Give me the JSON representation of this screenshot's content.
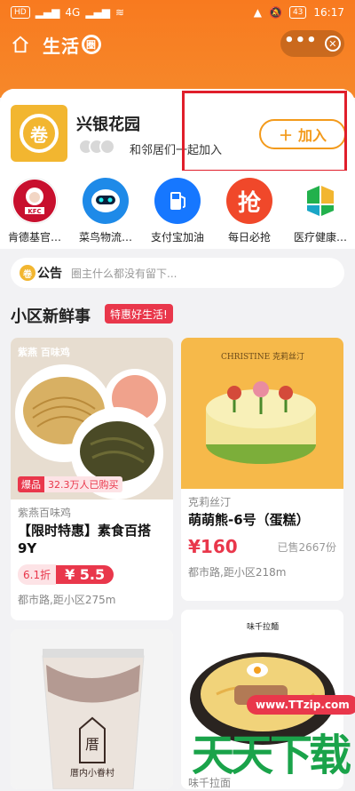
{
  "status": {
    "time": "16:17",
    "battery": "43",
    "hd": "HD",
    "net1": "4G",
    "net2": "4G"
  },
  "navbar": {
    "title": "生活",
    "title_ring": "圈"
  },
  "community": {
    "logo_char": "卷",
    "name": "兴银花园",
    "subtitle": "和邻居们一起加入",
    "join_label": "加入"
  },
  "apps": [
    {
      "label": "肯德基官…",
      "icon": "kfc-icon",
      "color": "#c8102e",
      "glyph": "KFC"
    },
    {
      "label": "菜鸟物流…",
      "icon": "robot-icon",
      "color": "#1e8ae8",
      "glyph": "●●"
    },
    {
      "label": "支付宝加油",
      "icon": "fuel-pump-icon",
      "color": "#1677ff",
      "glyph": "⛽"
    },
    {
      "label": "每日必抢",
      "icon": "grab-icon",
      "color": "#f0482a",
      "glyph": "抢"
    },
    {
      "label": "医疗健康…",
      "icon": "health-icon",
      "color": "#ffffff",
      "glyph": "✚"
    }
  ],
  "notice": {
    "tag": "公告",
    "tag_char": "卷",
    "text": "圈主什么都没有留下..."
  },
  "section": {
    "title": "小区新鲜事",
    "badge": "特惠好生活!"
  },
  "products": [
    {
      "merchant": "紫燕百味鸡",
      "title": "【限时特惠】素食百搭9Y",
      "hot_a": "爆品",
      "hot_b": "32.3万人已购买",
      "discount": "6.1折",
      "price": "¥ 5.5",
      "distance": "都市路,距小区275m",
      "brand": "紫燕 百味鸡"
    },
    {
      "merchant": "克莉丝汀",
      "title": "萌萌熊-6号（蛋糕）",
      "price": "¥160",
      "sold": "已售2667份",
      "distance": "都市路,距小区218m",
      "brand": "CHRISTINE 克莉丝汀"
    },
    {
      "merchant": "",
      "brand": "厝内小眷村"
    },
    {
      "merchant": "味千拉面",
      "brand": "味千拉麵"
    }
  ],
  "watermark": {
    "url": "www.TTzip.com",
    "text": "天天下载"
  }
}
